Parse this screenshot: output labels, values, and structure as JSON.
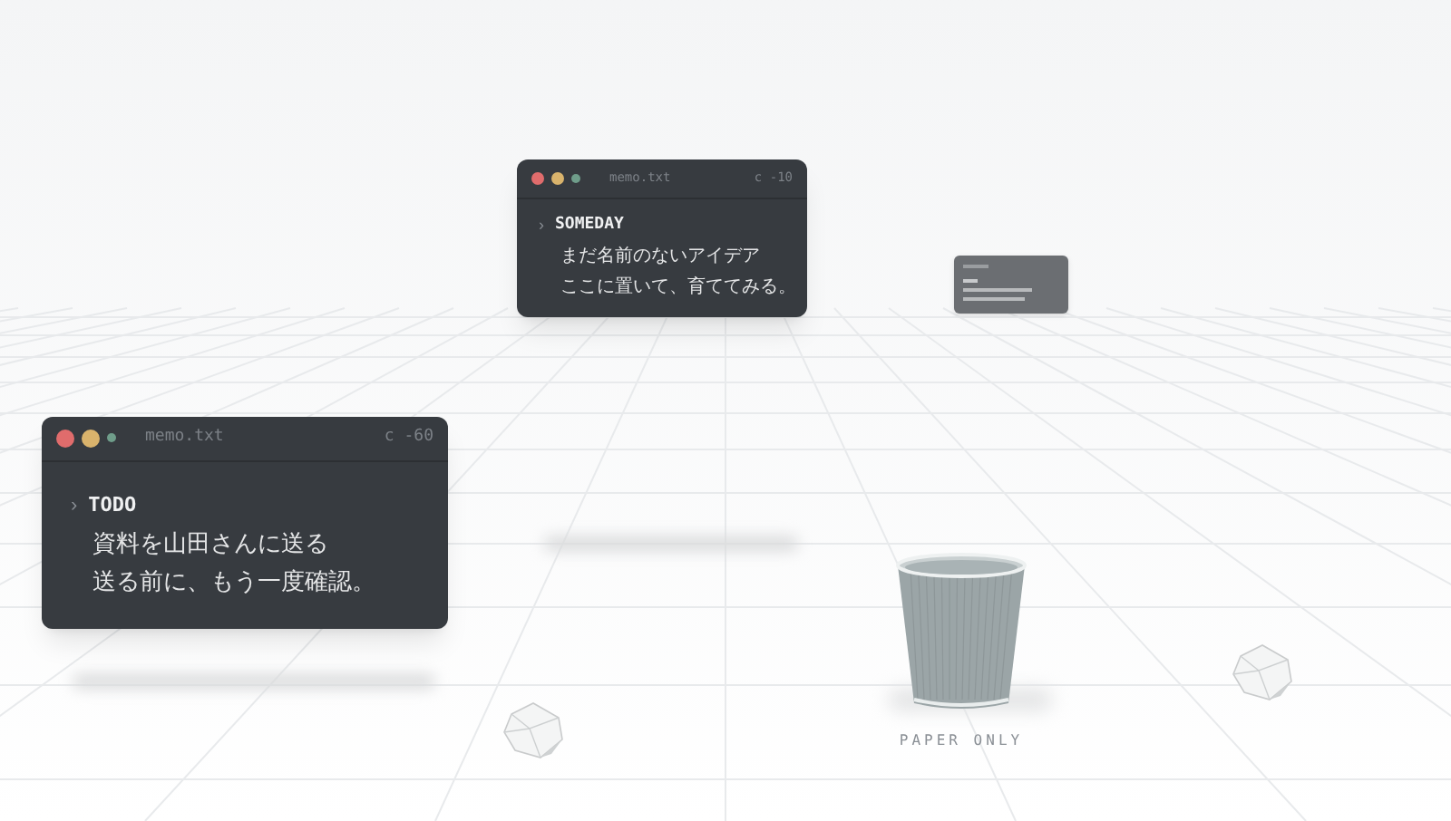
{
  "notes": [
    {
      "kind": "full",
      "title": "memo.txt",
      "shortcut": "c -10",
      "marker": "›",
      "heading": "SOMEDAY",
      "lines": [
        "まだ名前のないアイデア",
        "ここに置いて、育ててみる。"
      ]
    },
    {
      "kind": "distant"
    },
    {
      "kind": "full",
      "title": "memo.txt",
      "shortcut": "c -60",
      "marker": "›",
      "heading": "TODO",
      "lines": [
        "資料を山田さんに送る",
        "送る前に、もう一度確認。"
      ]
    }
  ],
  "bin": {
    "label": "PAPER ONLY"
  }
}
